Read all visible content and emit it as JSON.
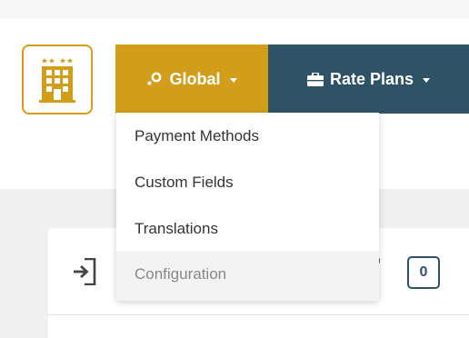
{
  "colors": {
    "accent_gold": "#d29e1a",
    "nav_blue": "#2e5266",
    "content_bg": "#f0f0f0"
  },
  "logo": {
    "icon": "hotel-building-icon"
  },
  "nav": {
    "global": {
      "icon": "gear-icon",
      "label": "Global"
    },
    "rate_plans": {
      "icon": "briefcase-icon",
      "label": "Rate Plans"
    }
  },
  "dropdown": {
    "items": [
      {
        "label": "Payment Methods"
      },
      {
        "label": "Custom Fields"
      },
      {
        "label": "Translations"
      },
      {
        "label": "Configuration"
      }
    ],
    "hovered_item": "Configuration"
  },
  "card": {
    "icon": "sign-in-icon",
    "mark": "'",
    "count": "0"
  }
}
